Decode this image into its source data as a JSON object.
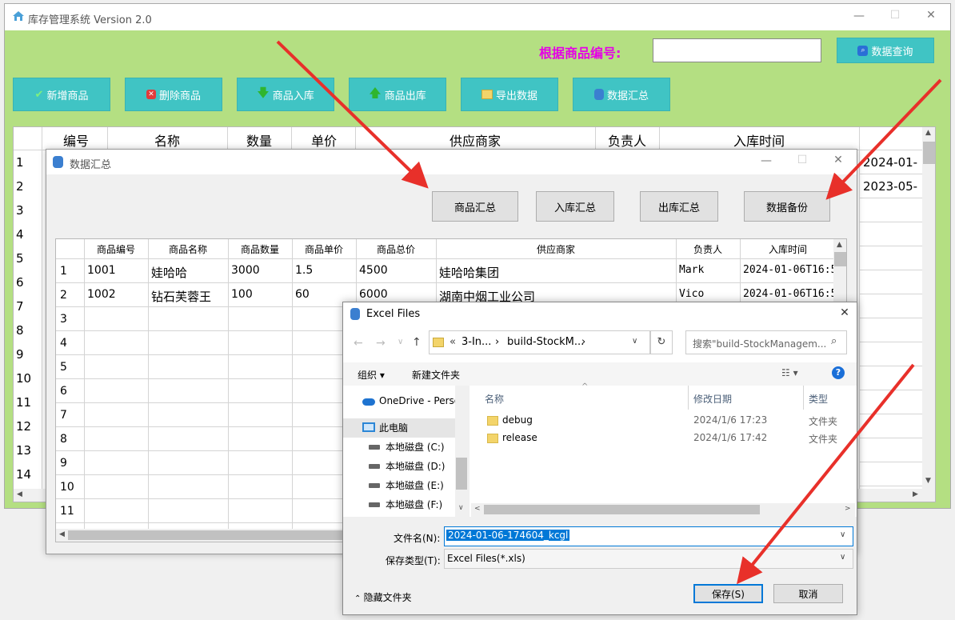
{
  "main": {
    "title": "库存管理系统 Version 2.0",
    "search_label": "根据商品编号:",
    "search_value": "",
    "search_button": "数据查询",
    "toolbar": [
      "新增商品",
      "删除商品",
      "商品入库",
      "商品出库",
      "导出数据",
      "数据汇总"
    ],
    "columns": [
      "编号",
      "名称",
      "数量",
      "单价",
      "供应商家",
      "负责人",
      "入库时间"
    ],
    "row_numbers": [
      "1",
      "2",
      "3",
      "4",
      "5",
      "6",
      "7",
      "8",
      "9",
      "10",
      "11",
      "12",
      "13",
      "14"
    ],
    "partial_dates": [
      "2024-01-",
      "2023-05-"
    ]
  },
  "summary": {
    "title": "数据汇总",
    "buttons": [
      "商品汇总",
      "入库汇总",
      "出库汇总",
      "数据备份"
    ],
    "columns": [
      "商品编号",
      "商品名称",
      "商品数量",
      "商品单价",
      "商品总价",
      "供应商家",
      "负责人",
      "入库时间"
    ],
    "rows": [
      [
        "1001",
        "娃哈哈",
        "3000",
        "1.5",
        "4500",
        "娃哈哈集团",
        "Mark",
        "2024-01-06T16:5"
      ],
      [
        "1002",
        "钻石芙蓉王",
        "100",
        "60",
        "6000",
        "湖南中烟工业公司",
        "Vico",
        "2024-01-06T16:5"
      ]
    ],
    "row_numbers": [
      "1",
      "2",
      "3",
      "4",
      "5",
      "6",
      "7",
      "8",
      "9",
      "10",
      "11"
    ]
  },
  "dialog": {
    "title": "Excel Files",
    "path": [
      "«",
      "3-In...",
      "›",
      "build-StockM...",
      "›"
    ],
    "search_placeholder": "搜索\"build-StockManagem...",
    "organize": "组织 ▾",
    "new_folder": "新建文件夹",
    "nav": [
      {
        "label": "OneDrive - Perso",
        "icon": "cloud-icon"
      },
      {
        "label": "此电脑",
        "icon": "computer-icon"
      },
      {
        "label": "本地磁盘 (C:)",
        "icon": "drive-icon"
      },
      {
        "label": "本地磁盘 (D:)",
        "icon": "drive-icon"
      },
      {
        "label": "本地磁盘 (E:)",
        "icon": "drive-icon"
      },
      {
        "label": "本地磁盘 (F:)",
        "icon": "drive-icon"
      }
    ],
    "file_columns": [
      "名称",
      "修改日期",
      "类型"
    ],
    "files": [
      {
        "name": "debug",
        "date": "2024/1/6 17:23",
        "type": "文件夹"
      },
      {
        "name": "release",
        "date": "2024/1/6 17:42",
        "type": "文件夹"
      }
    ],
    "filename_label": "文件名(N):",
    "filename_value": "2024-01-06-174604_kcgl",
    "filetype_label": "保存类型(T):",
    "filetype_value": "Excel Files(*.xls)",
    "hide_folders": "隐藏文件夹",
    "save": "保存(S)",
    "cancel": "取消"
  },
  "colors": {
    "green": "#b4df82",
    "teal": "#40c4c4",
    "magenta": "#e600e6",
    "arrow": "#e8302a",
    "select": "#0078d7"
  }
}
